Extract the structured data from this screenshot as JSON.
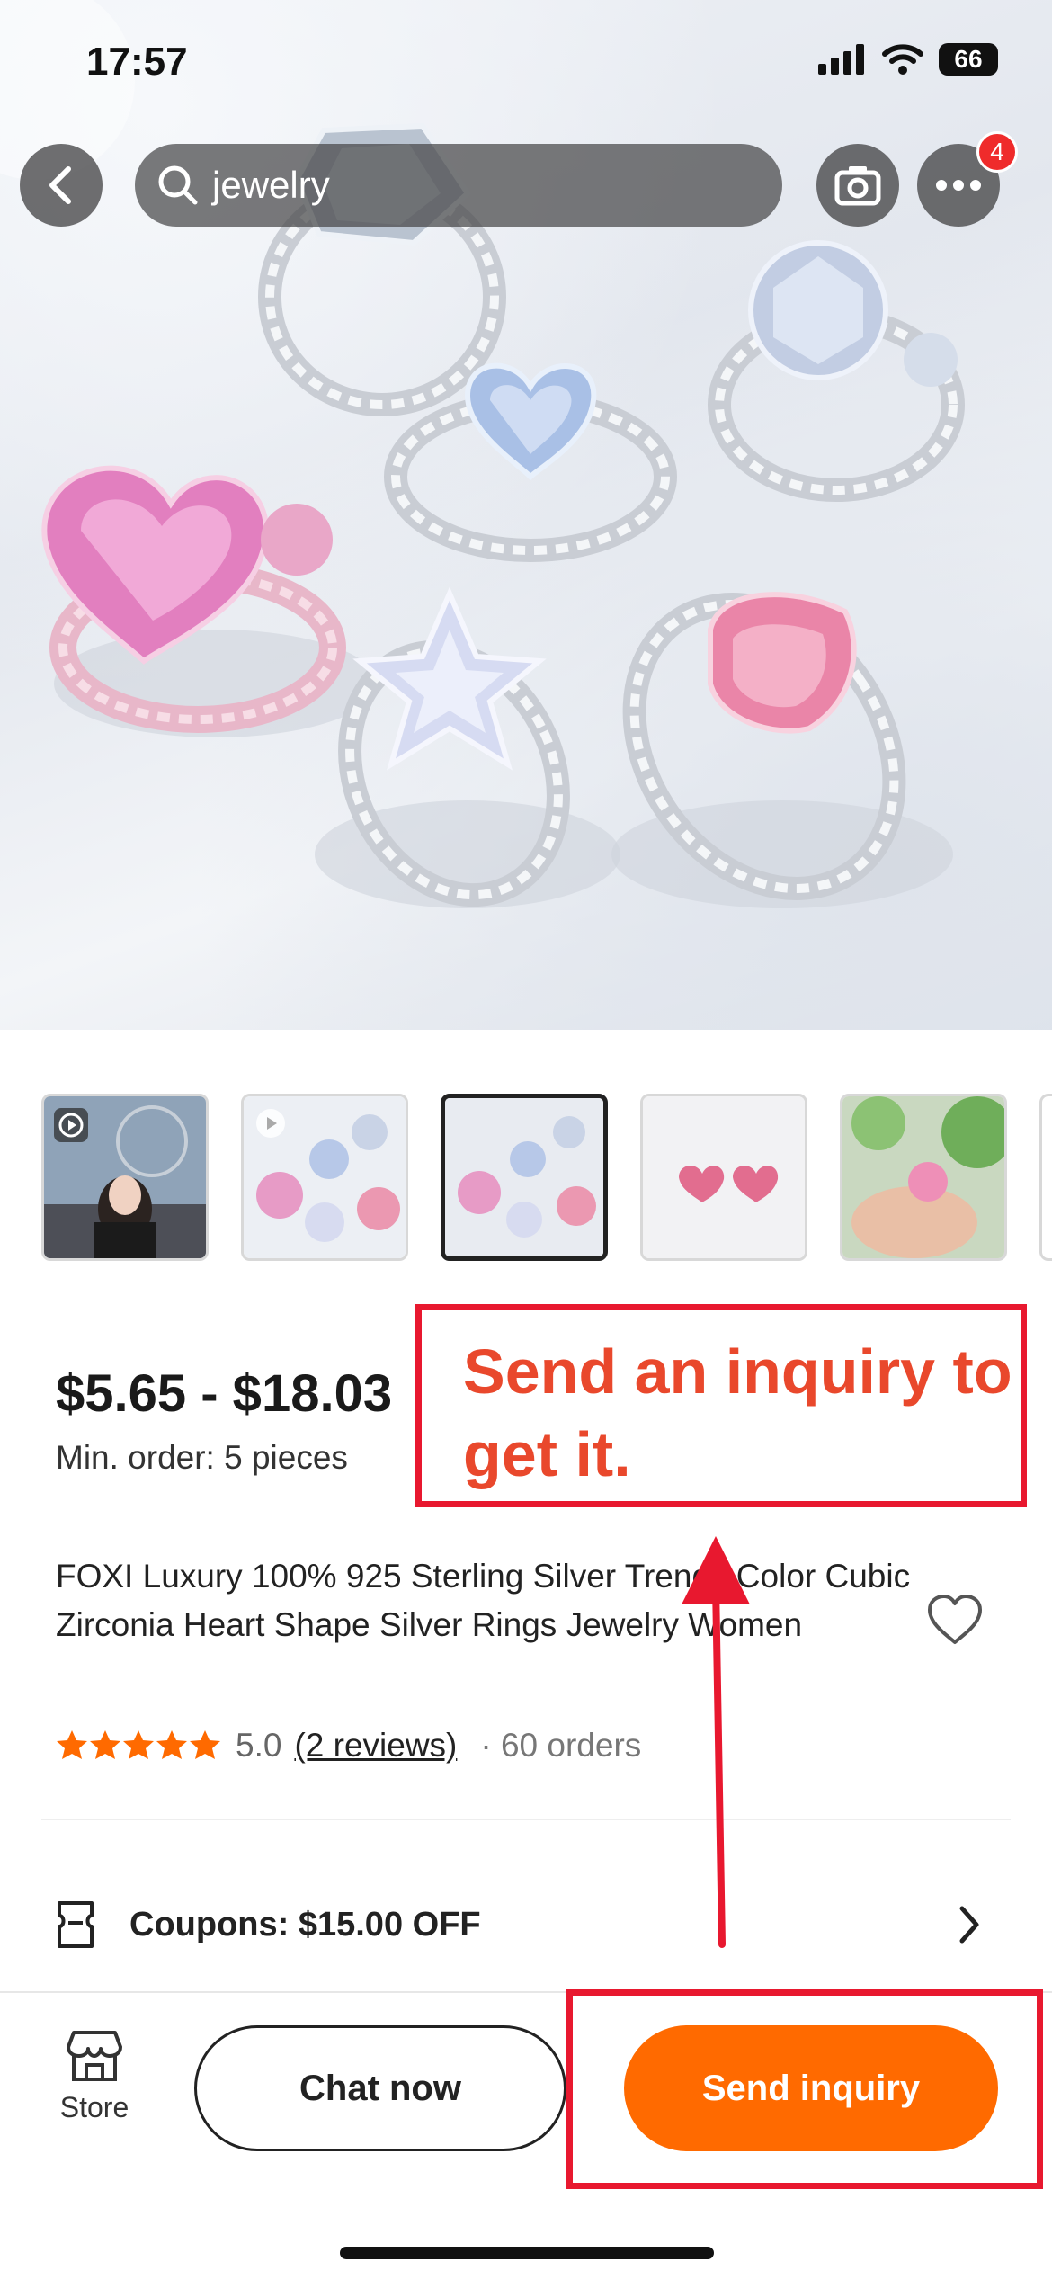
{
  "status_bar": {
    "time": "17:57",
    "battery": "66"
  },
  "nav": {
    "search_text": "jewelry",
    "notification_count": "4"
  },
  "thumbnails": [
    {
      "name": "video-thumb"
    },
    {
      "name": "image-thumb-1"
    },
    {
      "name": "image-thumb-2",
      "selected": true
    },
    {
      "name": "image-thumb-3"
    },
    {
      "name": "image-thumb-4"
    }
  ],
  "product": {
    "price": "$5.65 - $18.03",
    "min_order": "Min. order: 5 pieces",
    "title": "FOXI Luxury 100% 925 Sterling Silver Trendy Color Cubic Zirconia Heart Shape Silver Rings Jewelry Women",
    "rating": "5.0",
    "reviews": "(2 reviews)",
    "orders": "· 60 orders",
    "coupon": "Coupons: $15.00 OFF"
  },
  "bottom_bar": {
    "store_label": "Store",
    "chat_label": "Chat now",
    "inquiry_label": "Send inquiry"
  },
  "annotation": {
    "callout": "Send an inquiry to get it."
  },
  "colors": {
    "accent_orange": "#ff6a00",
    "star_orange": "#ff6a00",
    "annotation_red": "#e8182f",
    "annotation_text": "#e9482c",
    "badge_red": "#ef2b2b"
  }
}
